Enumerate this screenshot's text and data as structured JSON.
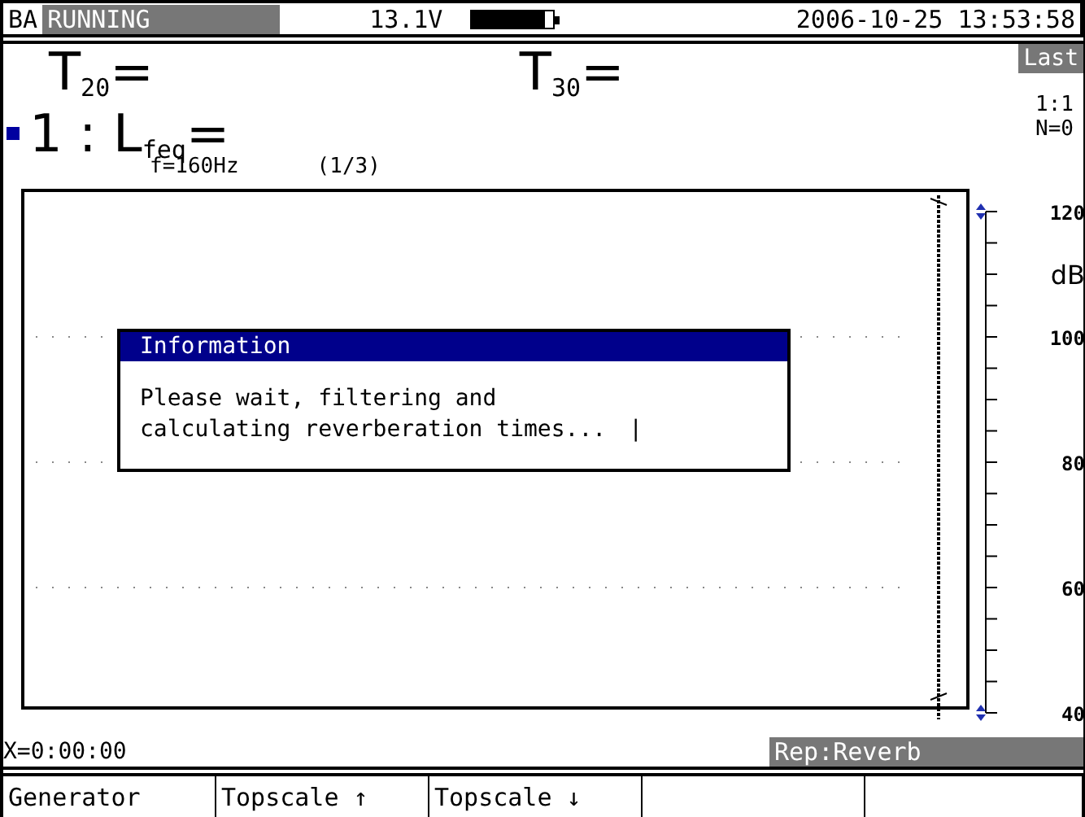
{
  "status_bar": {
    "mode": "BA",
    "state": "RUNNING",
    "voltage": "13.1V",
    "battery": {
      "level": 0.9
    },
    "datetime": "2006-10-25 13:53:58"
  },
  "results": {
    "t20": "T$_{20}$=",
    "t30": "T$_{30}$=",
    "channel": "1 : L$_{feq}$=",
    "frequency": "f=160Hz",
    "page": "(1/3)",
    "last": "Last",
    "ratio": "1:1",
    "count": "N=0"
  },
  "scale": {
    "unit": "dB",
    "ticks": [
      "120",
      "100",
      "80",
      "60",
      "40"
    ]
  },
  "dialog": {
    "title": "Information",
    "message": "Please wait, filtering and\ncalculating reverberation times...",
    "spinner": "|"
  },
  "cursor": "X=0:00:00",
  "mode_label": "Rep:Reverb",
  "softkeys": [
    "Generator",
    "Topscale ↑",
    "Topscale ↓"
  ]
}
